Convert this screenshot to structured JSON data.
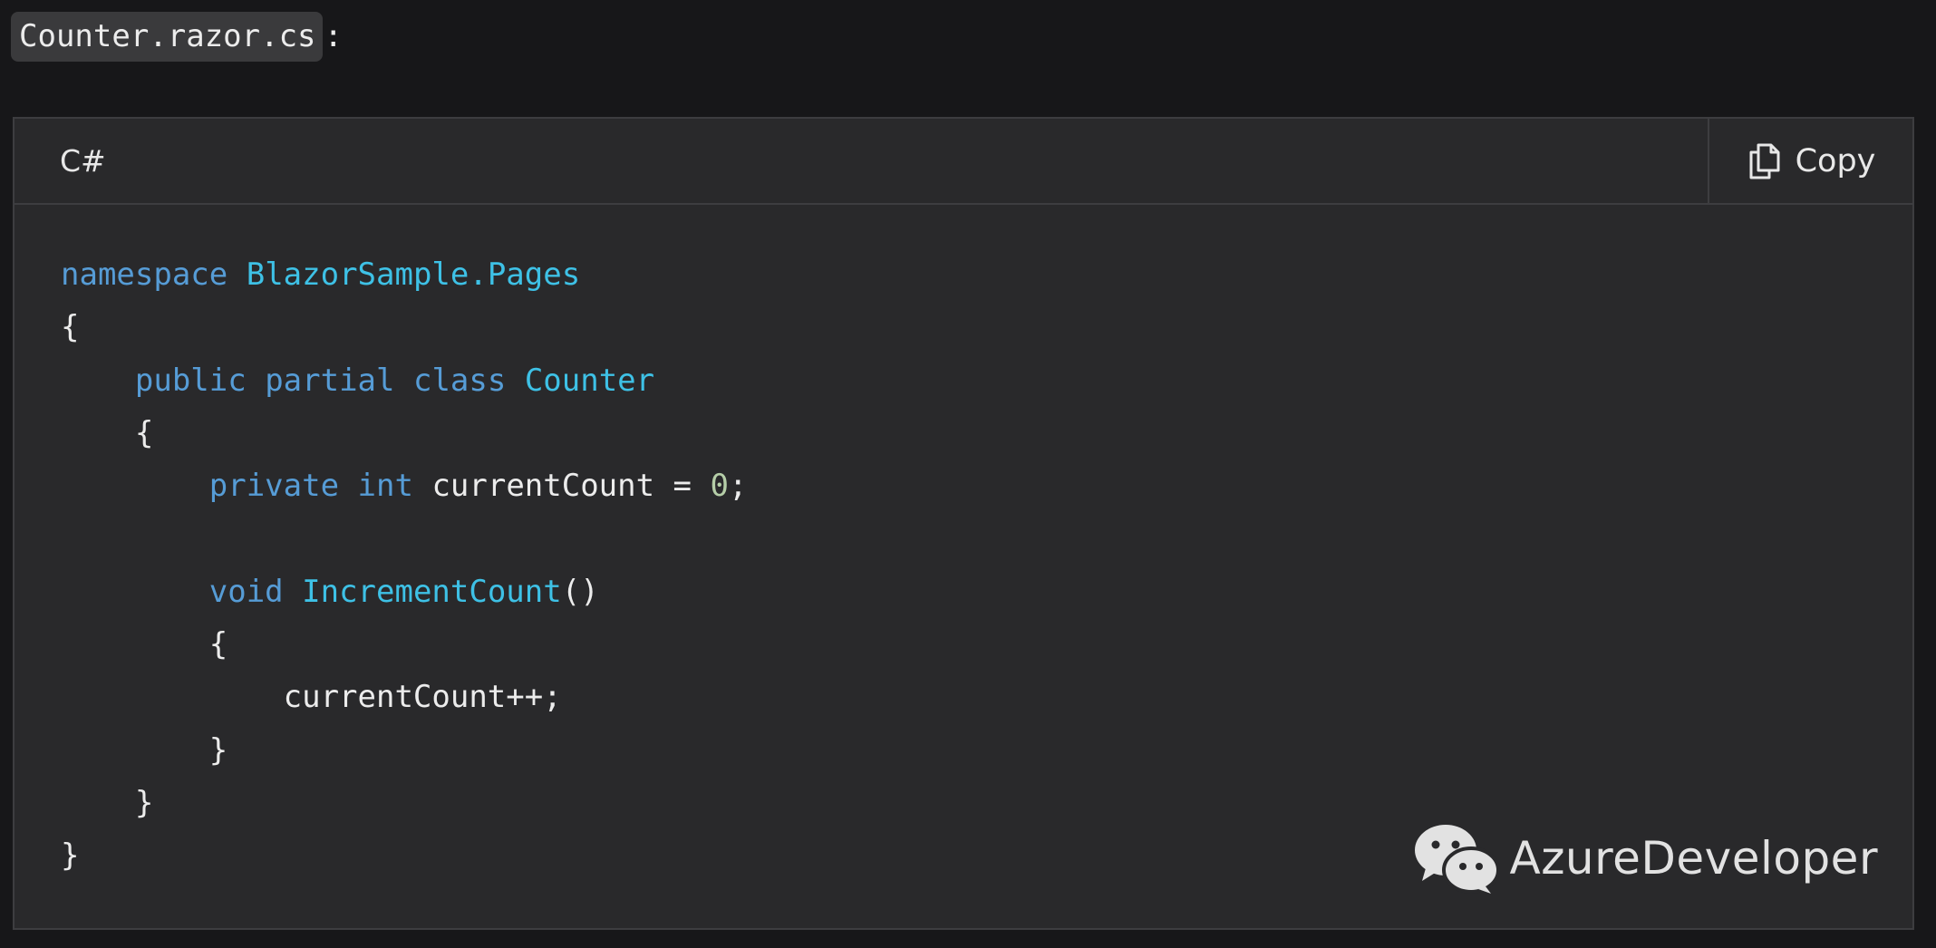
{
  "file": {
    "name": "Counter.razor.cs",
    "suffix": ":"
  },
  "code_block": {
    "language": "C#",
    "copy_label": "Copy",
    "lines": [
      [
        {
          "t": "namespace",
          "c": "kw"
        },
        {
          "t": " ",
          "c": "plain"
        },
        {
          "t": "BlazorSample.Pages",
          "c": "ty"
        }
      ],
      [
        {
          "t": "{",
          "c": "plain"
        }
      ],
      [
        {
          "t": "    ",
          "c": "plain"
        },
        {
          "t": "public",
          "c": "kw"
        },
        {
          "t": " ",
          "c": "plain"
        },
        {
          "t": "partial",
          "c": "kw"
        },
        {
          "t": " ",
          "c": "plain"
        },
        {
          "t": "class",
          "c": "kw"
        },
        {
          "t": " ",
          "c": "plain"
        },
        {
          "t": "Counter",
          "c": "ty"
        }
      ],
      [
        {
          "t": "    {",
          "c": "plain"
        }
      ],
      [
        {
          "t": "        ",
          "c": "plain"
        },
        {
          "t": "private",
          "c": "kw"
        },
        {
          "t": " ",
          "c": "plain"
        },
        {
          "t": "int",
          "c": "kw"
        },
        {
          "t": " currentCount = ",
          "c": "plain"
        },
        {
          "t": "0",
          "c": "num"
        },
        {
          "t": ";",
          "c": "plain"
        }
      ],
      [
        {
          "t": "",
          "c": "plain"
        }
      ],
      [
        {
          "t": "        ",
          "c": "plain"
        },
        {
          "t": "void",
          "c": "kw"
        },
        {
          "t": " ",
          "c": "plain"
        },
        {
          "t": "IncrementCount",
          "c": "ty"
        },
        {
          "t": "()",
          "c": "plain"
        }
      ],
      [
        {
          "t": "        {",
          "c": "plain"
        }
      ],
      [
        {
          "t": "            currentCount++;",
          "c": "plain"
        }
      ],
      [
        {
          "t": "        }",
          "c": "plain"
        }
      ],
      [
        {
          "t": "    }",
          "c": "plain"
        }
      ],
      [
        {
          "t": "}",
          "c": "plain"
        }
      ]
    ]
  },
  "watermark": {
    "icon": "wechat-icon",
    "text": "AzureDeveloper"
  },
  "icons": {
    "copy": "copy-icon"
  },
  "colors": {
    "keyword": "#569cd6",
    "type": "#3ec1e6",
    "number": "#b5cea8",
    "text": "#ececec",
    "background": "#29292b",
    "page_background": "#171719"
  }
}
